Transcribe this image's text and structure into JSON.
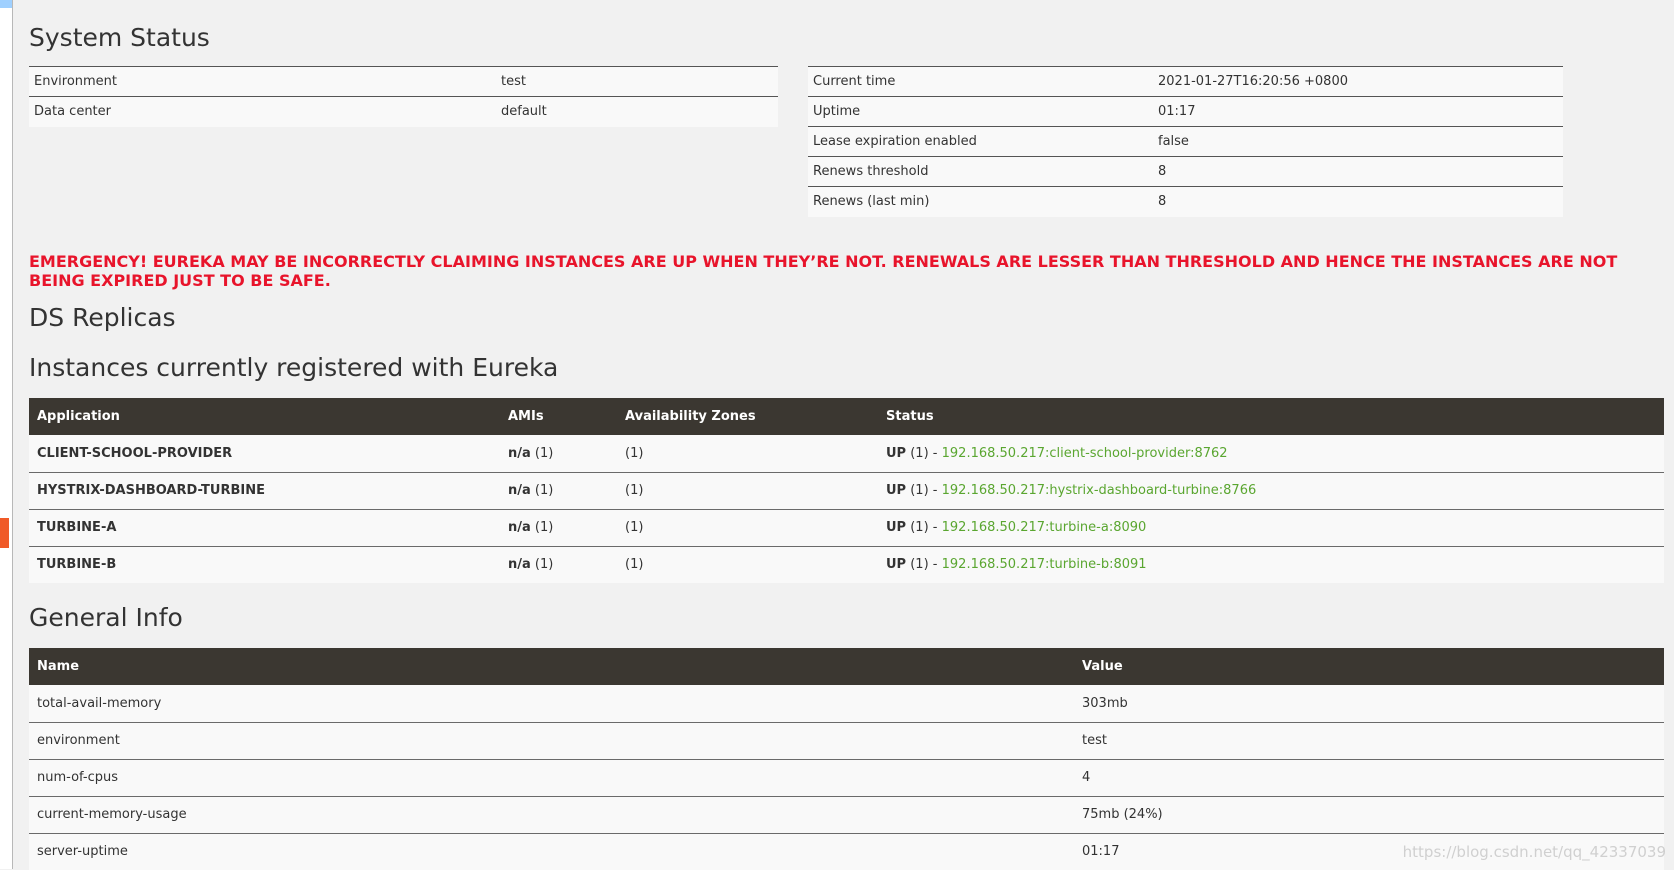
{
  "system_status": {
    "title": "System Status",
    "left_rows": [
      {
        "label": "Environment",
        "value": "test"
      },
      {
        "label": "Data center",
        "value": "default"
      }
    ],
    "right_rows": [
      {
        "label": "Current time",
        "value": "2021-01-27T16:20:56 +0800"
      },
      {
        "label": "Uptime",
        "value": "01:17"
      },
      {
        "label": "Lease expiration enabled",
        "value": "false"
      },
      {
        "label": "Renews threshold",
        "value": "8"
      },
      {
        "label": "Renews (last min)",
        "value": "8"
      }
    ]
  },
  "emergency_text": "EMERGENCY! EUREKA MAY BE INCORRECTLY CLAIMING INSTANCES ARE UP WHEN THEY’RE NOT. RENEWALS ARE LESSER THAN THRESHOLD AND HENCE THE INSTANCES ARE NOT BEING EXPIRED JUST TO BE SAFE.",
  "ds_replicas_title": "DS Replicas",
  "instances": {
    "title": "Instances currently registered with Eureka",
    "headers": {
      "application": "Application",
      "amis": "AMIs",
      "zones": "Availability Zones",
      "status": "Status"
    },
    "rows": [
      {
        "application": "CLIENT-SCHOOL-PROVIDER",
        "ami": "n/a",
        "ami_count": "(1)",
        "zones": "(1)",
        "status": "UP",
        "status_count": "(1) -",
        "link": "192.168.50.217:client-school-provider:8762"
      },
      {
        "application": "HYSTRIX-DASHBOARD-TURBINE",
        "ami": "n/a",
        "ami_count": "(1)",
        "zones": "(1)",
        "status": "UP",
        "status_count": "(1) -",
        "link": "192.168.50.217:hystrix-dashboard-turbine:8766"
      },
      {
        "application": "TURBINE-A",
        "ami": "n/a",
        "ami_count": "(1)",
        "zones": "(1)",
        "status": "UP",
        "status_count": "(1) -",
        "link": "192.168.50.217:turbine-a:8090"
      },
      {
        "application": "TURBINE-B",
        "ami": "n/a",
        "ami_count": "(1)",
        "zones": "(1)",
        "status": "UP",
        "status_count": "(1) -",
        "link": "192.168.50.217:turbine-b:8091"
      }
    ]
  },
  "general_info": {
    "title": "General Info",
    "headers": {
      "name": "Name",
      "value": "Value"
    },
    "rows": [
      {
        "name": "total-avail-memory",
        "value": "303mb"
      },
      {
        "name": "environment",
        "value": "test"
      },
      {
        "name": "num-of-cpus",
        "value": "4"
      },
      {
        "name": "current-memory-usage",
        "value": "75mb (24%)"
      },
      {
        "name": "server-uptime",
        "value": "01:17"
      }
    ]
  },
  "watermark": "https://blog.csdn.net/qq_42337039",
  "colors": {
    "emergency": "#e8142b",
    "header_bg": "#3b3731",
    "link": "#5aa630"
  }
}
